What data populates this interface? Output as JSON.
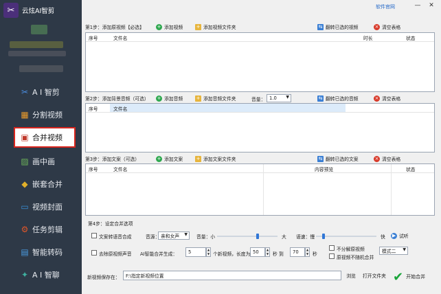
{
  "app": {
    "logo_icon": "scissors-icon",
    "name": "云炫AI智剪"
  },
  "sidebar": {
    "items": [
      {
        "label": "A I 智剪",
        "icon": "ai-cut-icon"
      },
      {
        "label": "分割视频",
        "icon": "split-video-icon"
      },
      {
        "label": "合并视频",
        "icon": "merge-video-icon"
      },
      {
        "label": "画中画",
        "icon": "picture-in-picture-icon"
      },
      {
        "label": "嵌套合并",
        "icon": "nested-merge-icon"
      },
      {
        "label": "视频封面",
        "icon": "video-cover-icon"
      },
      {
        "label": "任务剪辑",
        "icon": "task-edit-icon"
      },
      {
        "label": "智能转码",
        "icon": "transcode-icon"
      },
      {
        "label": "A I 智聊",
        "icon": "ai-chat-icon"
      }
    ],
    "active_index": 2
  },
  "topbar": {
    "official_link": "软件官网",
    "minimize": "—",
    "close": "✕"
  },
  "step1": {
    "title": "第1步：添加原视频【必选】",
    "add_video": "添加视频",
    "add_folder": "添加视频文件夹",
    "flip_selected": "翻转已选的视频",
    "clear": "清空表格",
    "columns": [
      "序号",
      "文件名",
      "时长",
      "状态"
    ]
  },
  "step2": {
    "title": "第2步：添加背景音频（可选）",
    "add_audio": "添加音频",
    "add_folder": "添加音频文件夹",
    "volume_label": "音量：",
    "volume_value": "1.0",
    "flip_selected": "翻转已选的音频",
    "clear": "清空表格",
    "columns": [
      "序号",
      "文件名"
    ]
  },
  "step3": {
    "title": "第3步：添加文案（可选）",
    "add_text": "添加文案",
    "add_folder": "添加文案文件夹",
    "flip_selected": "翻转已选的文案",
    "clear": "清空表格",
    "columns": [
      "序号",
      "文件名",
      "内容预览",
      "状态"
    ]
  },
  "step4": {
    "title": "第4步：设定合并选项",
    "tts_label": "文案转语音合成",
    "voice_label": "音源：",
    "voice_value": "亲和女声",
    "volume_label": "音量：小",
    "volume_big": "大",
    "volume_level": 0.67,
    "speed_label": "语速：慢",
    "speed_fast": "快",
    "speed_level": 0.12,
    "audition": "试听",
    "remove_audio_label": "去除原视频声音",
    "ai_merge_label": "AI智能合并生成：",
    "ai_merge_count": "5",
    "length_label": "个新视频，长度为：",
    "length_min": "50",
    "sec_to": "秒 到",
    "length_max": "70",
    "sec": "秒",
    "no_split_label": "不分解原视频",
    "no_random_label": "原视频不随机合并",
    "mode_value": "模式二"
  },
  "output": {
    "label": "新视频保存在：",
    "path": "F:\\指定新视频位置",
    "browse": "浏览",
    "open_folder": "打开文件夹",
    "start": "开始合并"
  }
}
